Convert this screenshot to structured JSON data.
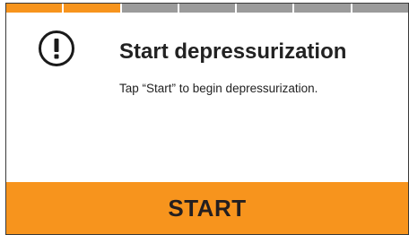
{
  "progress": {
    "total_steps": 7,
    "completed_steps": 2,
    "active_color": "#f7941d",
    "inactive_color": "#9b9b9b"
  },
  "dialog": {
    "icon": "exclamation-circle-icon",
    "title": "Start depressurization",
    "message": "Tap “Start” to begin depressurization."
  },
  "actions": {
    "start_label": "START",
    "start_color": "#f7941d"
  }
}
